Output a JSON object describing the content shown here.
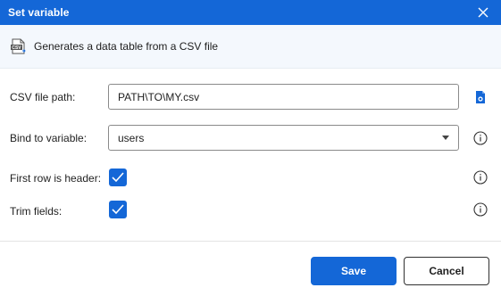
{
  "dialog": {
    "title": "Set variable",
    "close_icon": "close-icon",
    "description": "Generates a data table from a CSV file",
    "description_icon": "csv-file-icon"
  },
  "form": {
    "csv_path": {
      "label": "CSV file path:",
      "value": "PATH\\TO\\MY.csv",
      "icon": "browse-file-icon"
    },
    "bind_variable": {
      "label": "Bind to variable:",
      "value": "users",
      "info_icon": "info-icon"
    },
    "first_row_header": {
      "label": "First row is header:",
      "checked": true,
      "info_icon": "info-icon"
    },
    "trim_fields": {
      "label": "Trim fields:",
      "checked": true,
      "info_icon": "info-icon"
    }
  },
  "footer": {
    "save_label": "Save",
    "cancel_label": "Cancel"
  },
  "colors": {
    "accent": "#1467d7",
    "description_bg": "#f4f8fd"
  }
}
